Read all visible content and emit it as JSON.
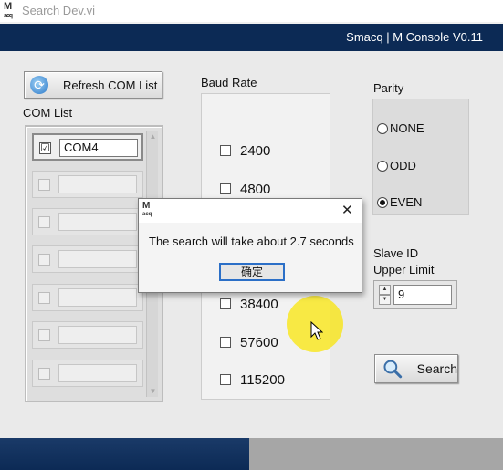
{
  "window": {
    "title": "Search Dev.vi",
    "app_icon_text": "M",
    "app_icon_subtext": "acq"
  },
  "header": {
    "title": "Smacq | M Console V0.11"
  },
  "toolbar": {
    "refresh_label": "Refresh COM List"
  },
  "com_list": {
    "label": "COM List",
    "items": [
      {
        "name": "COM4",
        "checked": true
      },
      {
        "name": "",
        "checked": false
      },
      {
        "name": "",
        "checked": false
      },
      {
        "name": "",
        "checked": false
      },
      {
        "name": "",
        "checked": false
      },
      {
        "name": "",
        "checked": false
      },
      {
        "name": "",
        "checked": false
      }
    ]
  },
  "baud_rate": {
    "label": "Baud Rate",
    "options": [
      "2400",
      "4800",
      "38400",
      "57600",
      "115200"
    ]
  },
  "parity": {
    "label": "Parity",
    "options": [
      "NONE",
      "ODD",
      "EVEN"
    ],
    "selected": "EVEN"
  },
  "slave_id": {
    "label_line1": "Slave ID",
    "label_line2": "Upper Limit",
    "value": "9"
  },
  "search": {
    "label": "Search"
  },
  "dialog": {
    "message": "The search will take about 2.7 seconds",
    "ok_label": "确定",
    "close_glyph": "✕"
  },
  "colors": {
    "header_bg": "#0c2a55",
    "cursor_highlight": "#fae400",
    "dialog_focus": "#2b6fc7"
  }
}
